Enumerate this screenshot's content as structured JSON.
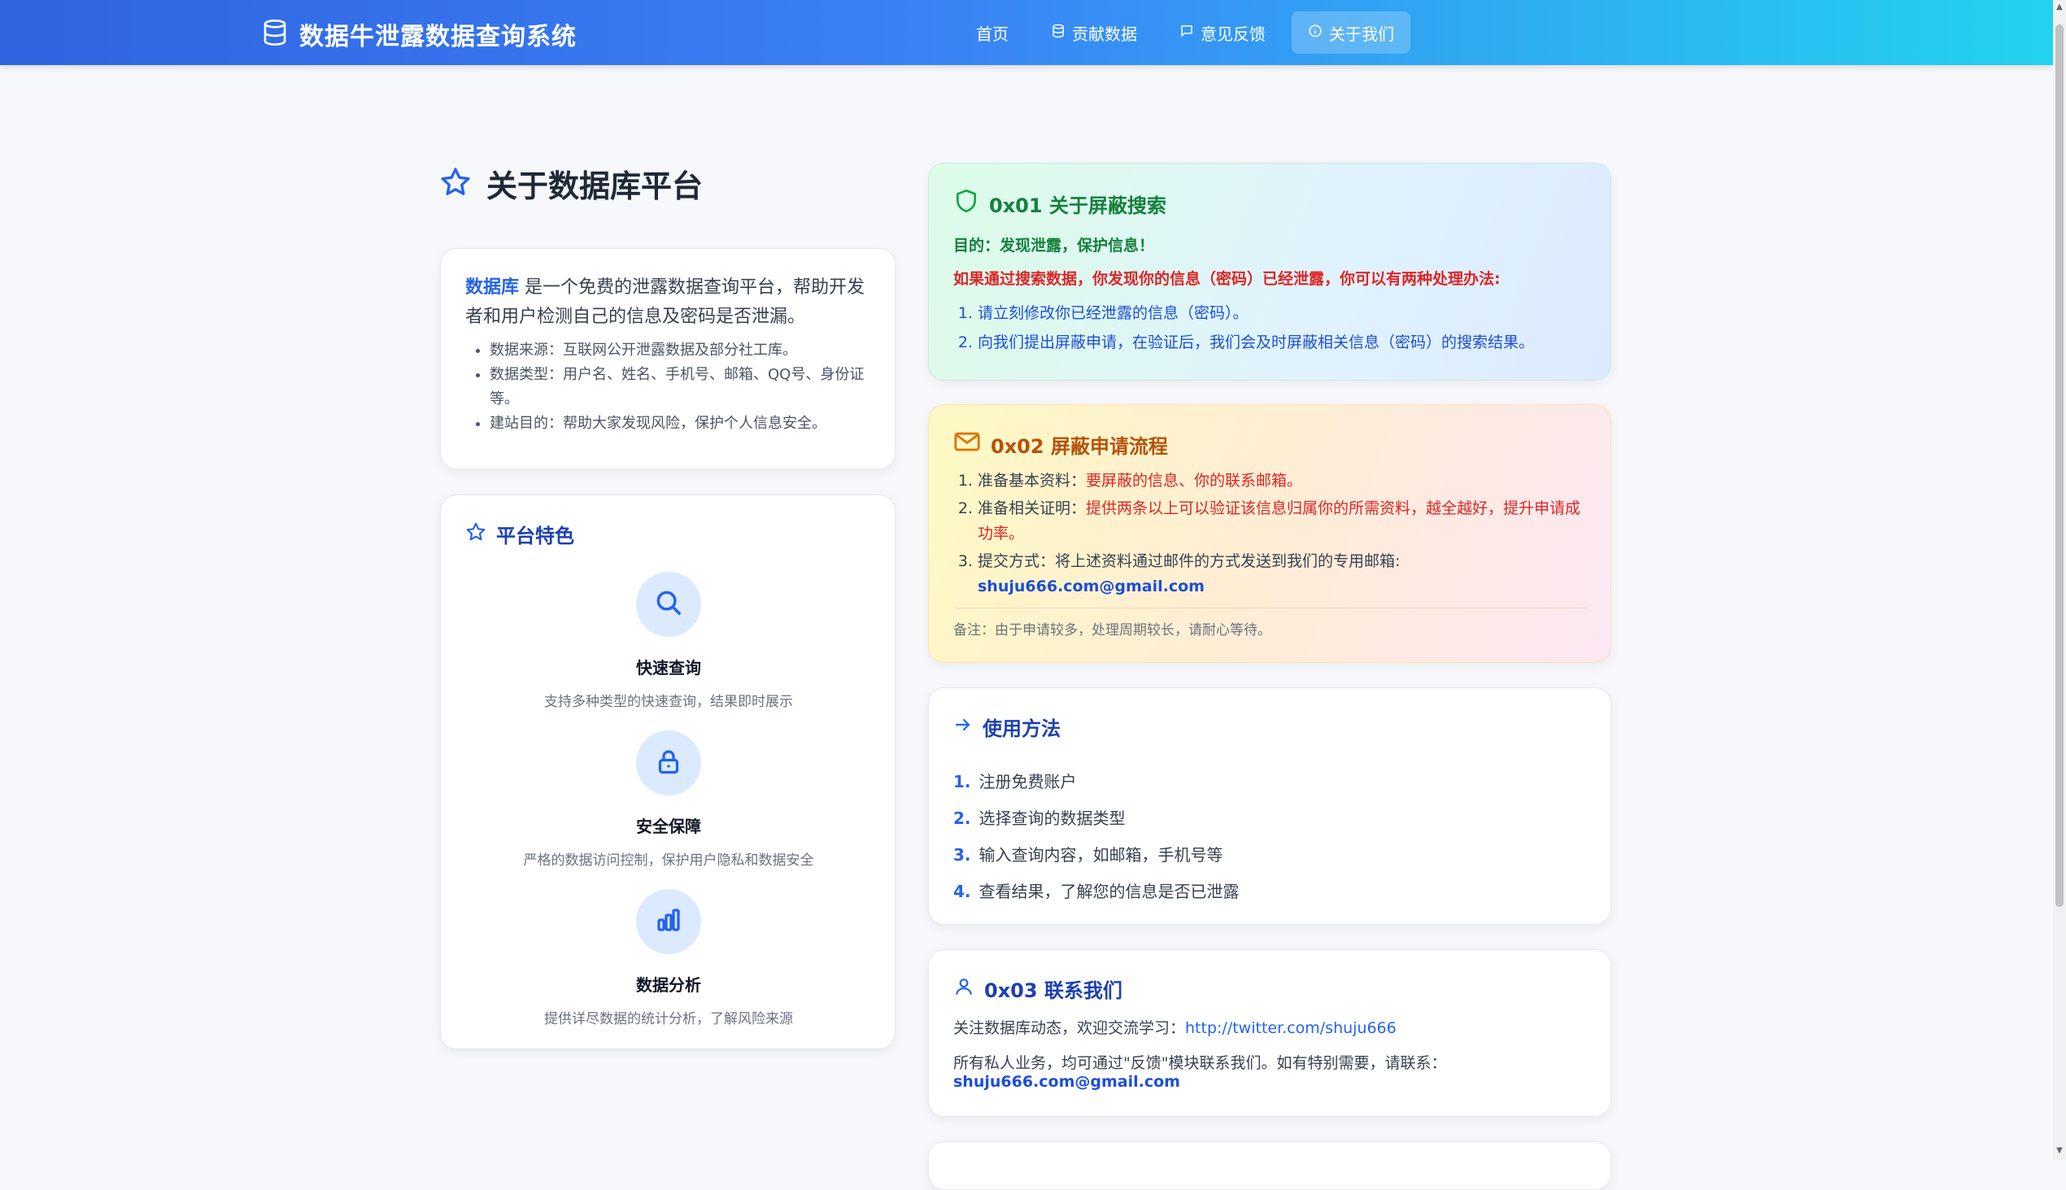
{
  "header": {
    "brand": "数据牛泄露数据查询系统",
    "nav": [
      {
        "label": "首页",
        "icon": ""
      },
      {
        "label": "贡献数据",
        "icon": "database-icon"
      },
      {
        "label": "意见反馈",
        "icon": "message-icon"
      },
      {
        "label": "关于我们",
        "icon": "info-icon",
        "active": true
      }
    ]
  },
  "page": {
    "title": "关于数据库平台"
  },
  "intro": {
    "highlight": "数据库",
    "lead": " 是一个免费的泄露数据查询平台，帮助开发者和用户检测自己的信息及密码是否泄漏。",
    "items": [
      "数据来源：互联网公开泄露数据及部分社工库。",
      "数据类型：用户名、姓名、手机号、邮箱、QQ号、身份证等。",
      "建站目的：帮助大家发现风险，保护个人信息安全。"
    ]
  },
  "features": {
    "title": "平台特色",
    "items": [
      {
        "title": "快速查询",
        "desc": "支持多种类型的快速查询，结果即时展示",
        "icon": "search-icon"
      },
      {
        "title": "安全保障",
        "desc": "严格的数据访问控制，保护用户隐私和数据安全",
        "icon": "lock-icon"
      },
      {
        "title": "数据分析",
        "desc": "提供详尽数据的统计分析，了解风险来源",
        "icon": "bar-chart-icon"
      }
    ]
  },
  "shield": {
    "title": "0x01 关于屏蔽搜索",
    "purpose": "目的：发现泄露，保护信息！",
    "warning": "如果通过搜索数据，你发现你的信息（密码）已经泄露，你可以有两种处理办法:",
    "steps": [
      "请立刻修改你已经泄露的信息（密码）。",
      "向我们提出屏蔽申请，在验证后，我们会及时屏蔽相关信息（密码）的搜索结果。"
    ]
  },
  "apply": {
    "title": "0x02 屏蔽申请流程",
    "step1_label": "准备基本资料：",
    "step1_value": "要屏蔽的信息、你的联系邮箱。",
    "step2_label": "准备相关证明：",
    "step2_value": "提供两条以上可以验证该信息归属你的所需资料，越全越好，提升申请成功率。",
    "step3_label": "提交方式：将上述资料通过邮件的方式发送到我们的专用邮箱:",
    "email": "shuju666.com@gmail.com",
    "note": "备注：由于申请较多，处理周期较长，请耐心等待。"
  },
  "usage": {
    "title": "使用方法",
    "steps": [
      "注册免费账户",
      "选择查询的数据类型",
      "输入查询内容，如邮箱，手机号等",
      "查看结果，了解您的信息是否已泄露"
    ]
  },
  "contact": {
    "title": "0x03 联系我们",
    "line1": "关注数据库动态，欢迎交流学习：",
    "twitter": "http://twitter.com/shuju666",
    "line2": "所有私人业务，均可通过\"反馈\"模块联系我们。如有特别需要，请联系：",
    "email": "shuju666.com@gmail.com"
  },
  "colors": {
    "primary": "#2563eb",
    "header_start": "#2f63e0",
    "header_end": "#22d3ee",
    "danger": "#dc2626",
    "success": "#15803d",
    "warning": "#b45309"
  }
}
